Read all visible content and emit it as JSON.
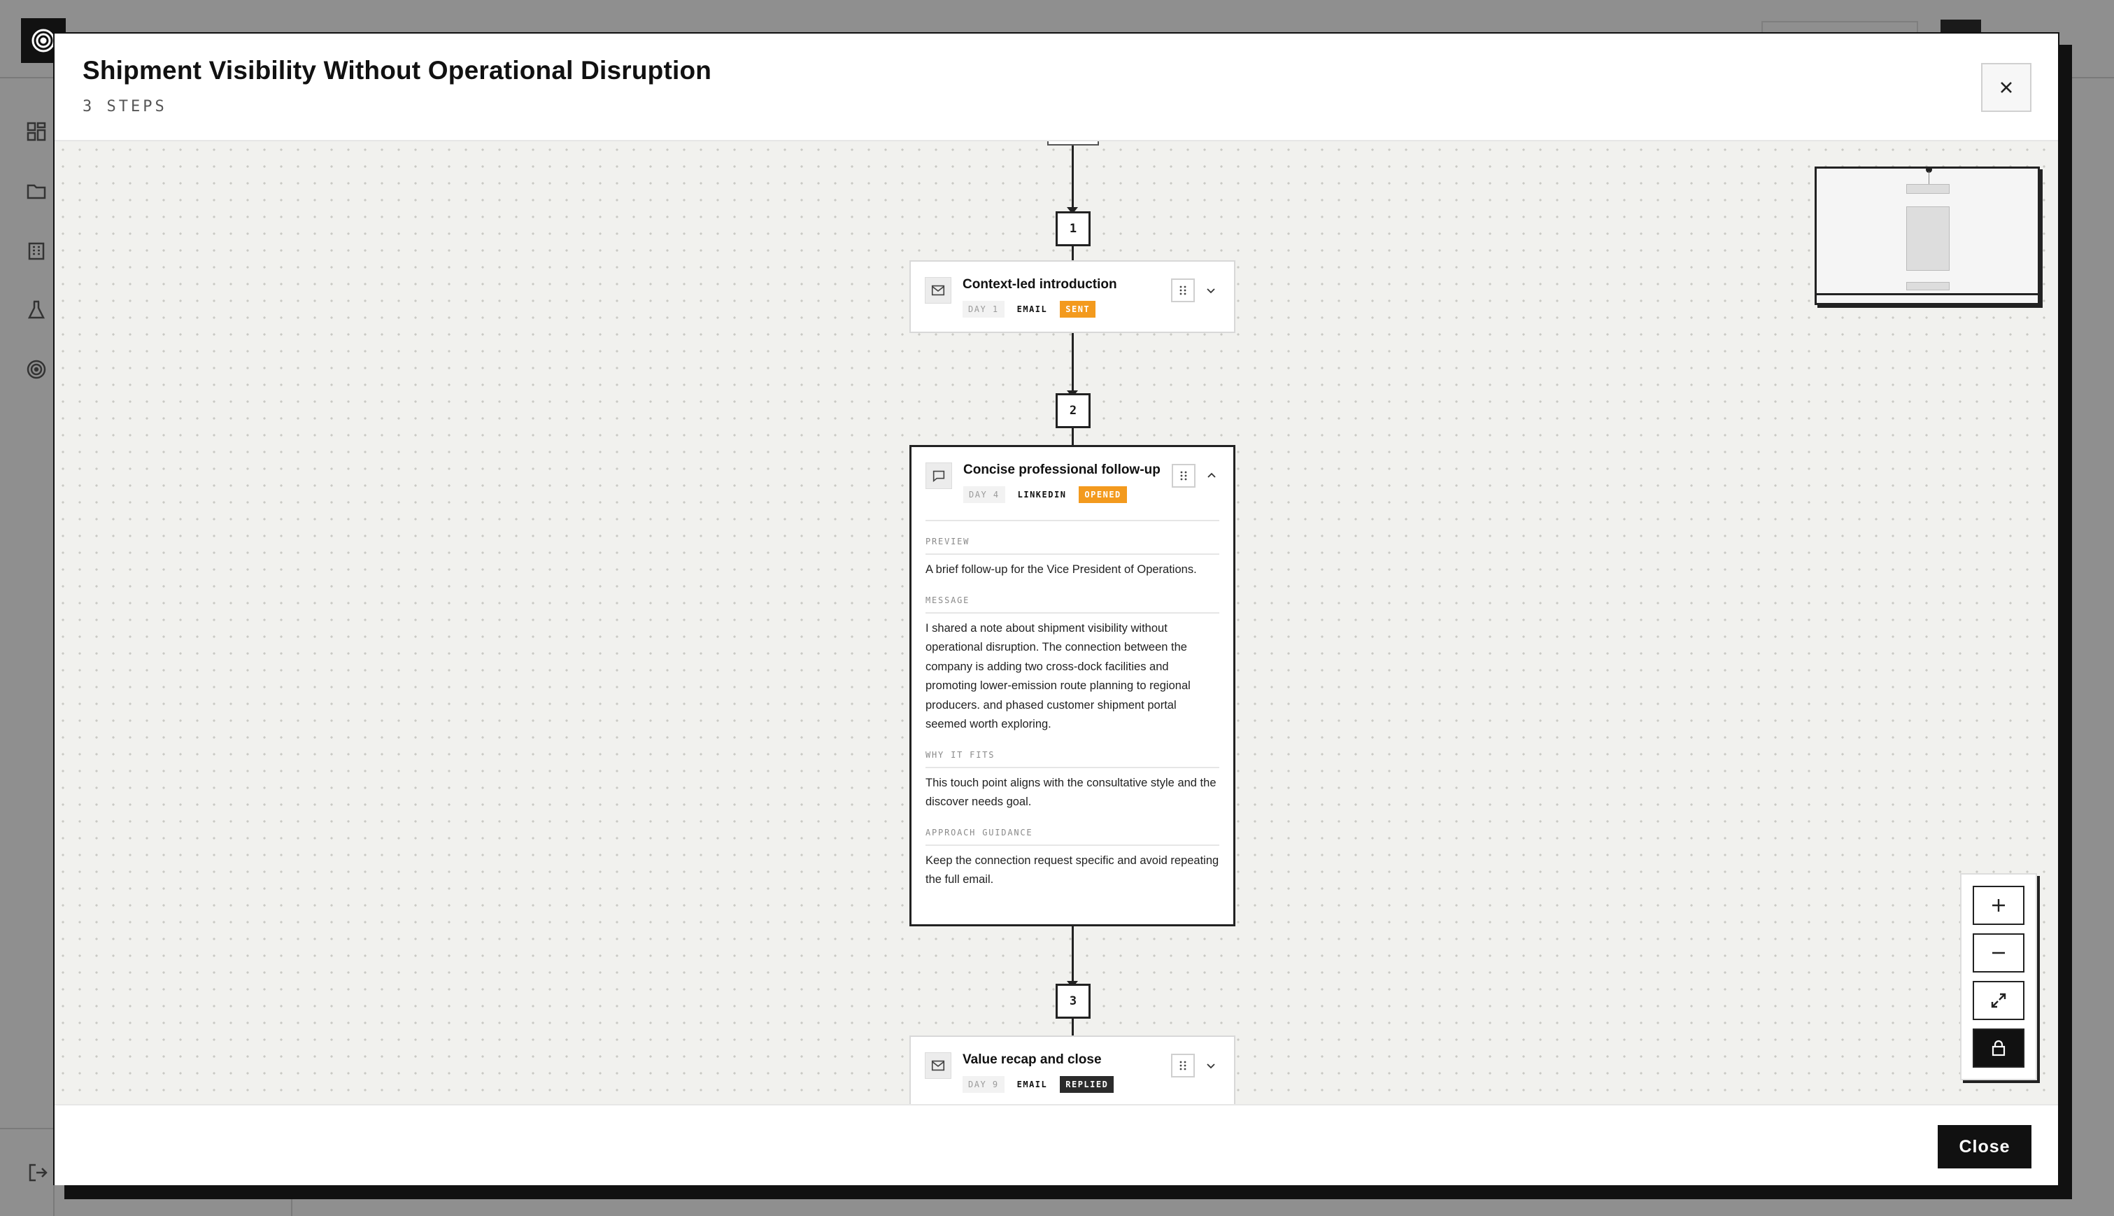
{
  "modal": {
    "title": "Shipment Visibility Without Operational Disruption",
    "subtitle": "3 STEPS",
    "close_label": "Close"
  },
  "flow": {
    "steps": [
      {
        "number": "1",
        "title": "Context-led introduction",
        "day": "DAY 1",
        "channel": "EMAIL",
        "status": "SENT",
        "status_color": "#F39A1E",
        "icon": "mail-icon",
        "expanded": false
      },
      {
        "number": "2",
        "title": "Concise professional follow-up",
        "day": "DAY 4",
        "channel": "LINKEDIN",
        "status": "OPENED",
        "status_color": "#F39A1E",
        "icon": "message-icon",
        "expanded": true,
        "sections": {
          "preview_label": "PREVIEW",
          "preview": "A brief follow-up for the Vice President of Operations.",
          "message_label": "MESSAGE",
          "message": "I shared a note about shipment visibility without operational disruption. The connection between the company is adding two cross-dock facilities and promoting lower-emission route planning to regional producers. and phased customer shipment portal seemed worth exploring.",
          "why_label": "WHY IT FITS",
          "why": "This touch point aligns with the consultative style and the discover needs goal.",
          "approach_label": "APPROACH GUIDANCE",
          "approach": "Keep the connection request specific and avoid repeating the full email."
        }
      },
      {
        "number": "3",
        "title": "Value recap and close",
        "day": "DAY 9",
        "channel": "EMAIL",
        "status": "REPLIED",
        "status_color": "#2B2B2B",
        "icon": "mail-icon",
        "expanded": false
      }
    ]
  },
  "controls": [
    "zoom-in-icon",
    "zoom-out-icon",
    "fit-view-icon",
    "lock-icon"
  ],
  "background": {
    "user_fragment": "en"
  }
}
